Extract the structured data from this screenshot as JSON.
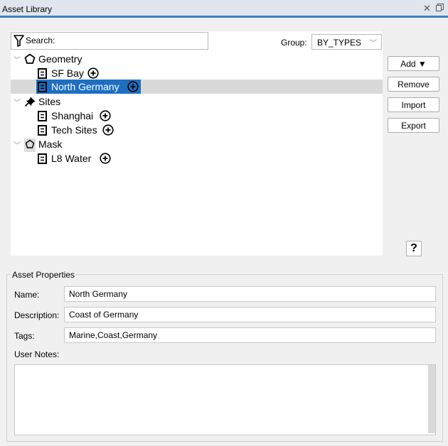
{
  "window": {
    "title": "Asset Library",
    "close_icon": "close-icon",
    "restore_icon": "restore-icon"
  },
  "search": {
    "placeholder": "Search:",
    "value": ""
  },
  "group": {
    "label": "Group:",
    "selected": "BY_TYPES"
  },
  "tree": {
    "categories": [
      {
        "label": "Geometry",
        "icon": "pentagon-icon",
        "items": [
          {
            "label": "SF Bay"
          },
          {
            "label": "North Germany",
            "selected": true
          }
        ]
      },
      {
        "label": "Sites",
        "icon": "pin-icon",
        "items": [
          {
            "label": "Shanghai"
          },
          {
            "label": "Tech Sites"
          }
        ]
      },
      {
        "label": "Mask",
        "icon": "mask-pentagon-icon",
        "items": [
          {
            "label": "L8 Water"
          }
        ]
      }
    ]
  },
  "buttons": {
    "add": "Add ▼",
    "remove": "Remove",
    "import": "Import",
    "export": "Export",
    "help": "?"
  },
  "properties": {
    "legend": "Asset Properties",
    "name_label": "Name:",
    "name_value": "North Germany",
    "description_label": "Description:",
    "description_value": "Coast of Germany",
    "tags_label": "Tags:",
    "tags_value": "Marine,Coast,Germany",
    "notes_label": "User Notes:",
    "notes_value": ""
  },
  "colors": {
    "selection": "#1e6fc1",
    "title_accent": "#3d7fc4"
  }
}
